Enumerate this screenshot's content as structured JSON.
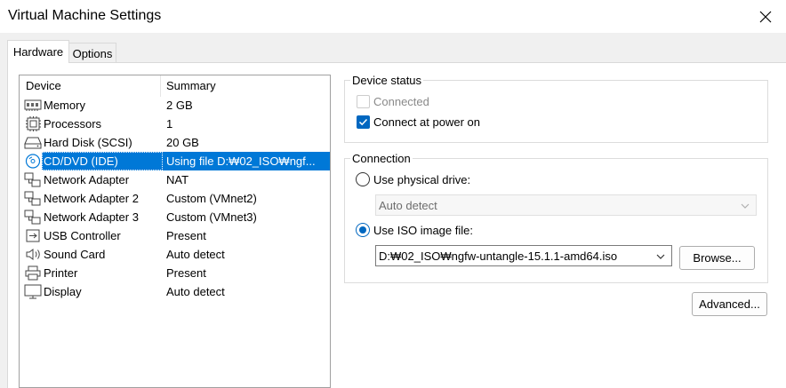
{
  "window": {
    "title": "Virtual Machine Settings",
    "close_icon": "close-icon"
  },
  "tabs": [
    {
      "label": "Hardware",
      "selected": true
    },
    {
      "label": "Options",
      "selected": false
    }
  ],
  "device_list": {
    "columns": [
      "Device",
      "Summary"
    ],
    "rows": [
      {
        "icon": "memory-icon",
        "device": "Memory",
        "summary": "2 GB"
      },
      {
        "icon": "processor-icon",
        "device": "Processors",
        "summary": "1"
      },
      {
        "icon": "hard-disk-icon",
        "device": "Hard Disk (SCSI)",
        "summary": "20 GB"
      },
      {
        "icon": "cd-dvd-icon",
        "device": "CD/DVD (IDE)",
        "summary": "Using file D:₩02_ISO₩ngf...",
        "selected": true
      },
      {
        "icon": "network-adapter-icon",
        "device": "Network Adapter",
        "summary": "NAT"
      },
      {
        "icon": "network-adapter-icon",
        "device": "Network Adapter 2",
        "summary": "Custom (VMnet2)"
      },
      {
        "icon": "network-adapter-icon",
        "device": "Network Adapter 3",
        "summary": "Custom (VMnet3)"
      },
      {
        "icon": "usb-icon",
        "device": "USB Controller",
        "summary": "Present"
      },
      {
        "icon": "speaker-icon",
        "device": "Sound Card",
        "summary": "Auto detect"
      },
      {
        "icon": "printer-icon",
        "device": "Printer",
        "summary": "Present"
      },
      {
        "icon": "display-icon",
        "device": "Display",
        "summary": "Auto detect"
      }
    ]
  },
  "device_status": {
    "label": "Device status",
    "connected": {
      "label": "Connected",
      "checked": false,
      "enabled": false
    },
    "connect_at_power_on": {
      "label": "Connect at power on",
      "checked": true,
      "enabled": true
    }
  },
  "connection": {
    "label": "Connection",
    "physical_drive": {
      "label": "Use physical drive:",
      "selected": false,
      "value": "Auto detect"
    },
    "iso_image": {
      "label": "Use ISO image file:",
      "selected": true,
      "value": "D:₩02_ISO₩ngfw-untangle-15.1.1-amd64.iso"
    },
    "browse_label": "Browse..."
  },
  "advanced_label": "Advanced...",
  "colors": {
    "accent": "#0067c0",
    "selection": "#0078d7"
  }
}
